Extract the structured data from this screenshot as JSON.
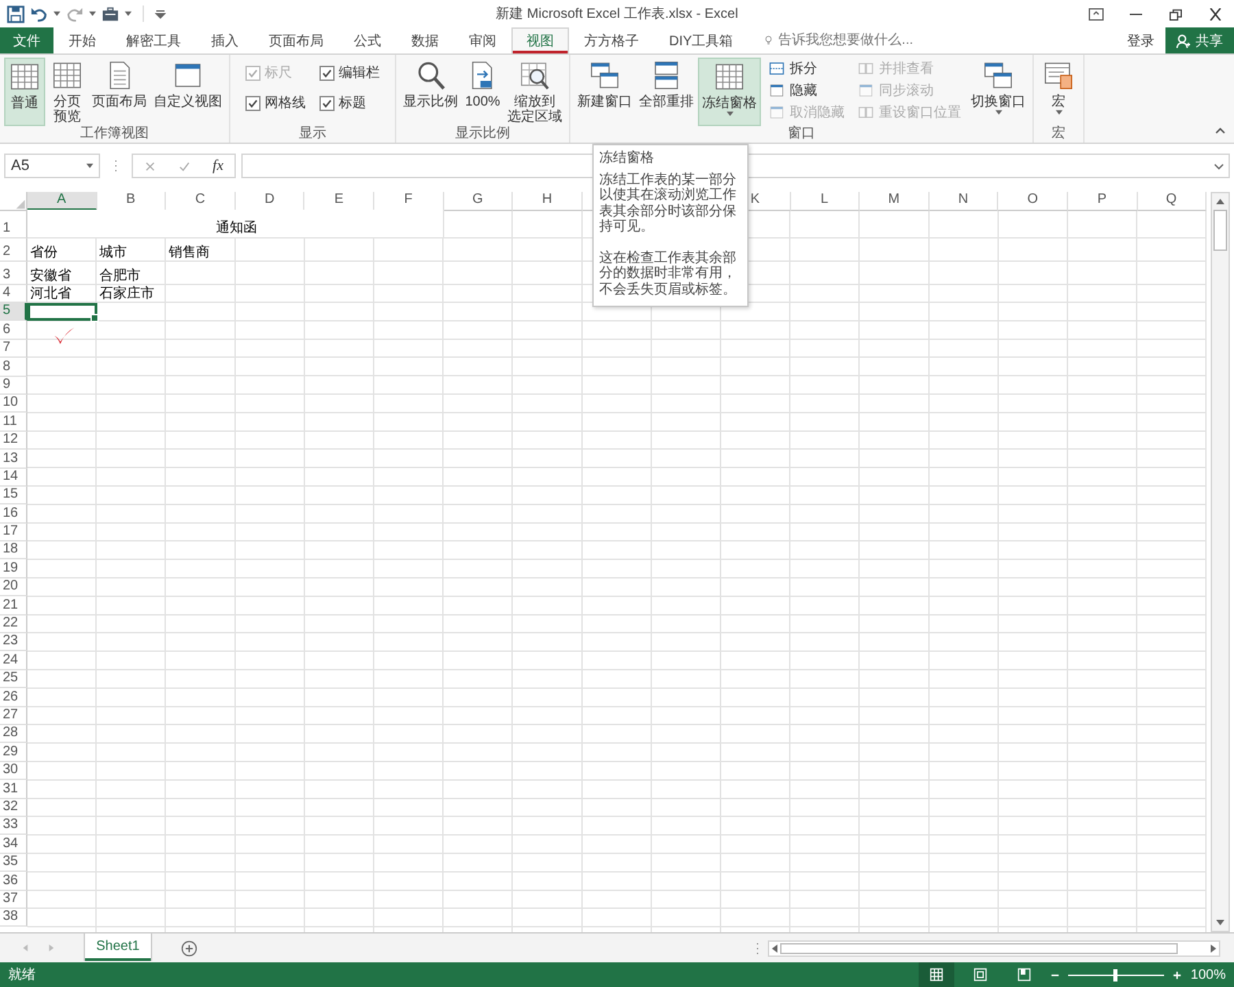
{
  "window": {
    "title": "新建 Microsoft Excel 工作表.xlsx - Excel"
  },
  "tabs": [
    {
      "kind": "file",
      "label": "文件",
      "selected": false
    },
    {
      "kind": "tab",
      "label": "开始",
      "selected": false
    },
    {
      "kind": "tab",
      "label": "解密工具",
      "selected": false
    },
    {
      "kind": "tab",
      "label": "插入",
      "selected": false
    },
    {
      "kind": "tab",
      "label": "页面布局",
      "selected": false
    },
    {
      "kind": "tab",
      "label": "公式",
      "selected": false
    },
    {
      "kind": "tab",
      "label": "数据",
      "selected": false
    },
    {
      "kind": "tab",
      "label": "审阅",
      "selected": false
    },
    {
      "kind": "tab",
      "label": "视图",
      "selected": true
    },
    {
      "kind": "tab",
      "label": "方方格子",
      "selected": false
    },
    {
      "kind": "tab",
      "label": "DIY工具箱",
      "selected": false
    }
  ],
  "tell_me": {
    "placeholder": "告诉我您想要做什么..."
  },
  "sign_in": "登录",
  "share": "共享",
  "ribbon": {
    "groups": [
      {
        "label": "工作簿视图",
        "items": [
          {
            "kind": "large",
            "label": "普通",
            "highlighted": true,
            "dropdown": false
          },
          {
            "kind": "large",
            "label_lines": [
              "分页",
              "预览"
            ],
            "highlighted": false,
            "dropdown": false
          },
          {
            "kind": "large",
            "label": "页面布局",
            "highlighted": false,
            "dropdown": false
          },
          {
            "kind": "large",
            "label": "自定义视图",
            "highlighted": false,
            "dropdown": false
          }
        ]
      },
      {
        "label": "显示",
        "items": [
          {
            "kind": "checkbox",
            "label": "标尺",
            "checked": true,
            "disabled": true
          },
          {
            "kind": "checkbox",
            "label": "编辑栏",
            "checked": true,
            "disabled": false
          },
          {
            "kind": "checkbox",
            "label": "网格线",
            "checked": true,
            "disabled": false
          },
          {
            "kind": "checkbox",
            "label": "标题",
            "checked": true,
            "disabled": false
          }
        ]
      },
      {
        "label": "显示比例",
        "items": [
          {
            "kind": "large",
            "label": "显示比例",
            "highlighted": false,
            "dropdown": false
          },
          {
            "kind": "large",
            "label": "100%",
            "highlighted": false,
            "dropdown": false
          },
          {
            "kind": "large",
            "label_lines": [
              "缩放到",
              "选定区域"
            ],
            "highlighted": false,
            "dropdown": false
          }
        ]
      },
      {
        "label": "窗口",
        "items": [
          {
            "kind": "large",
            "label": "新建窗口",
            "highlighted": false,
            "dropdown": false
          },
          {
            "kind": "large",
            "label": "全部重排",
            "highlighted": false,
            "dropdown": false
          },
          {
            "kind": "large",
            "label": "冻结窗格",
            "highlighted": true,
            "dropdown": true
          },
          {
            "kind": "small",
            "label": "拆分",
            "disabled": false
          },
          {
            "kind": "small",
            "label": "隐藏",
            "disabled": false
          },
          {
            "kind": "small",
            "label": "取消隐藏",
            "disabled": true
          },
          {
            "kind": "small",
            "label": "并排查看",
            "disabled": true
          },
          {
            "kind": "small",
            "label": "同步滚动",
            "disabled": true
          },
          {
            "kind": "small",
            "label": "重设窗口位置",
            "disabled": true
          },
          {
            "kind": "large",
            "label": "切换窗口",
            "highlighted": false,
            "dropdown": true
          }
        ]
      },
      {
        "label": "宏",
        "items": [
          {
            "kind": "large",
            "label": "宏",
            "highlighted": false,
            "dropdown": true
          }
        ]
      }
    ]
  },
  "tooltip": {
    "title": "冻结窗格",
    "paragraphs": [
      "冻结工作表的某一部分以使其在滚动浏览工作表其余部分时该部分保持可见。",
      "这在检查工作表其余部分的数据时非常有用，不会丢失页眉或标签。"
    ]
  },
  "formula_bar": {
    "name_box": "A5",
    "function_label": "fx"
  },
  "columns": [
    {
      "label": "A",
      "selected": true
    },
    {
      "label": "B",
      "selected": false
    },
    {
      "label": "C",
      "selected": false
    },
    {
      "label": "D",
      "selected": false
    },
    {
      "label": "E",
      "selected": false
    },
    {
      "label": "F",
      "selected": false
    },
    {
      "label": "G",
      "selected": false
    },
    {
      "label": "H",
      "selected": false
    },
    {},
    {},
    {
      "label": "K",
      "selected": false
    },
    {
      "label": "L",
      "selected": false
    },
    {
      "label": "M",
      "selected": false
    },
    {
      "label": "N",
      "selected": false
    },
    {
      "label": "O",
      "selected": false
    },
    {
      "label": "P",
      "selected": false
    },
    {
      "label": "Q",
      "selected": false
    }
  ],
  "rows": [
    {
      "header": "1",
      "selected": false,
      "merged_title": "通知函"
    },
    {
      "header": "2",
      "selected": false,
      "cells": [
        "省份",
        "城市",
        "销售商"
      ]
    },
    {
      "header": "3",
      "selected": false,
      "cells": [
        "安徽省",
        "合肥市"
      ]
    },
    {
      "header": "4",
      "selected": false,
      "cells": [
        "河北省",
        "石家庄市"
      ]
    },
    {
      "header": "5",
      "selected": true
    },
    {
      "header": "6",
      "selected": false
    },
    {
      "header": "7",
      "selected": false
    },
    {
      "header": "8",
      "selected": false
    },
    {
      "header": "9",
      "selected": false
    },
    {
      "header": "10",
      "selected": false
    },
    {
      "header": "11",
      "selected": false
    },
    {
      "header": "12",
      "selected": false
    },
    {
      "header": "13",
      "selected": false
    },
    {
      "header": "14",
      "selected": false
    },
    {
      "header": "15",
      "selected": false
    },
    {
      "header": "16",
      "selected": false
    },
    {
      "header": "17",
      "selected": false
    },
    {
      "header": "18",
      "selected": false
    },
    {
      "header": "19",
      "selected": false
    },
    {
      "header": "20",
      "selected": false
    },
    {
      "header": "21",
      "selected": false
    },
    {
      "header": "22",
      "selected": false
    },
    {
      "header": "23",
      "selected": false
    },
    {
      "header": "24",
      "selected": false
    },
    {
      "header": "25",
      "selected": false
    },
    {
      "header": "26",
      "selected": false
    },
    {
      "header": "27",
      "selected": false
    },
    {
      "header": "28",
      "selected": false
    },
    {
      "header": "29",
      "selected": false
    },
    {
      "header": "30",
      "selected": false
    },
    {
      "header": "31",
      "selected": false
    },
    {
      "header": "32",
      "selected": false
    },
    {
      "header": "33",
      "selected": false
    },
    {
      "header": "34",
      "selected": false
    },
    {
      "header": "35",
      "selected": false
    },
    {
      "header": "36",
      "selected": false
    },
    {
      "header": "37",
      "selected": false
    },
    {
      "header": "38",
      "selected": false
    }
  ],
  "sheets": [
    {
      "label": "Sheet1",
      "selected": true
    }
  ],
  "status_bar": {
    "text": "就绪",
    "views": [
      {
        "selected": true
      },
      {
        "selected": false
      },
      {
        "selected": false
      }
    ],
    "zoom": {
      "level": 0.5,
      "reading": "100%"
    }
  }
}
